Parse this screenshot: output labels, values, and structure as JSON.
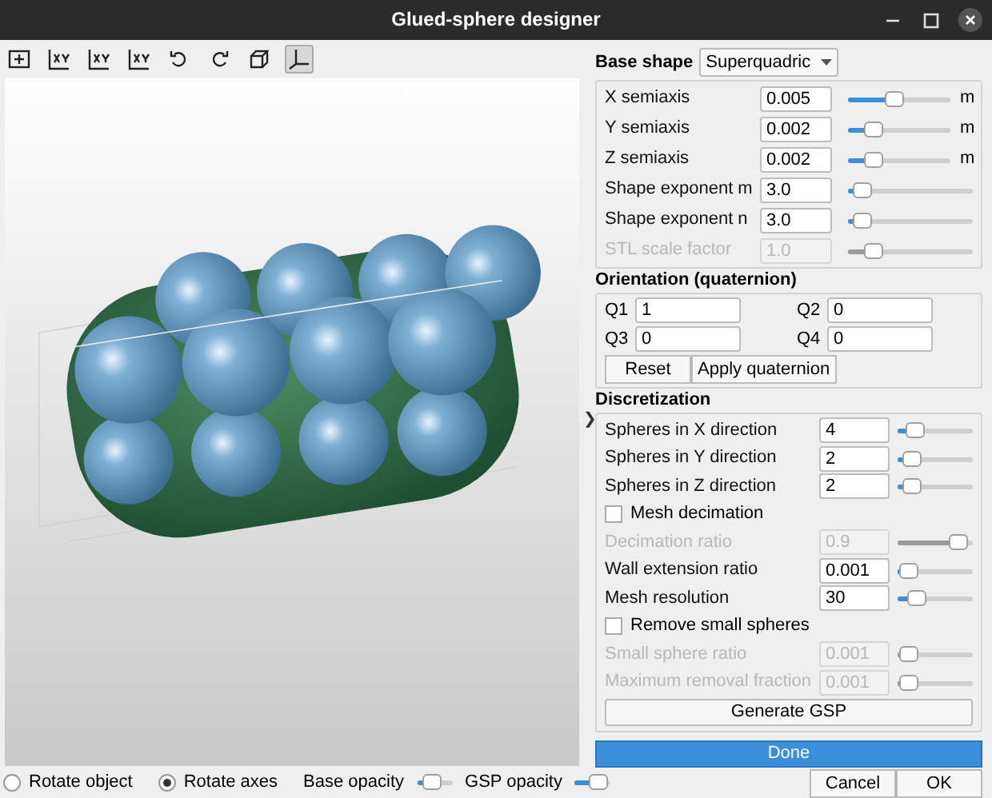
{
  "window": {
    "title": "Glued-sphere designer"
  },
  "toolbar": [
    {
      "selected": false
    },
    {
      "selected": false
    },
    {
      "selected": false
    },
    {
      "selected": false
    },
    {
      "selected": false
    },
    {
      "selected": false
    },
    {
      "selected": false
    },
    {
      "selected": true
    }
  ],
  "view_modes": [
    {
      "label": "Rotate object",
      "selected": false
    },
    {
      "label": "Rotate axes",
      "selected": true
    }
  ],
  "opacity": [
    {
      "label": "Base opacity",
      "level": 0.3
    },
    {
      "label": "GSP opacity",
      "level": 0.9
    }
  ],
  "splitter": {
    "glyph": "❯"
  },
  "base_shape": {
    "label": "Base shape",
    "value": "Superquadric"
  },
  "shape_params": [
    {
      "label": "X semiaxis",
      "value": "0.005",
      "level": 0.45,
      "unit": "m",
      "disabled": false
    },
    {
      "label": "Y semiaxis",
      "value": "0.002",
      "level": 0.2,
      "unit": "m",
      "disabled": false
    },
    {
      "label": "Z semiaxis",
      "value": "0.002",
      "level": 0.2,
      "unit": "m",
      "disabled": false
    },
    {
      "label": "Shape exponent m",
      "value": "3.0",
      "level": 0.05,
      "disabled": false
    },
    {
      "label": "Shape exponent n",
      "value": "3.0",
      "level": 0.05,
      "disabled": false
    },
    {
      "label": "STL scale factor",
      "value": "1.0",
      "level": 0.15,
      "disabled": true
    }
  ],
  "orientation": {
    "title": "Orientation (quaternion)",
    "fields": [
      {
        "label": "Q1",
        "value": "1"
      },
      {
        "label": "Q2",
        "value": "0"
      },
      {
        "label": "Q3",
        "value": "0"
      },
      {
        "label": "Q4",
        "value": "0"
      }
    ],
    "buttons": [
      "Reset",
      "Apply quaternion"
    ]
  },
  "discretization": {
    "title": "Discretization",
    "items": [
      {
        "kind": "slider",
        "label": "Spheres in X direction",
        "value": "4",
        "level": 0.15,
        "disabled": false
      },
      {
        "kind": "slider",
        "label": "Spheres in Y direction",
        "value": "2",
        "level": 0.08,
        "disabled": false
      },
      {
        "kind": "slider",
        "label": "Spheres in Z direction",
        "value": "2",
        "level": 0.08,
        "disabled": false
      },
      {
        "kind": "checkbox",
        "label": "Mesh decimation",
        "checked": false
      },
      {
        "kind": "slider",
        "label": "Decimation ratio",
        "value": "0.9",
        "level": 0.9,
        "disabled": true
      },
      {
        "kind": "slider",
        "label": "Wall extension ratio",
        "value": "0.001",
        "level": 0.02,
        "disabled": false
      },
      {
        "kind": "slider",
        "label": "Mesh resolution",
        "value": "30",
        "level": 0.18,
        "disabled": false
      },
      {
        "kind": "checkbox",
        "label": "Remove small spheres",
        "checked": false
      },
      {
        "kind": "slider",
        "label": "Small sphere ratio",
        "value": "0.001",
        "level": 0.02,
        "disabled": true
      },
      {
        "kind": "slider",
        "label": "Maximum removal fraction",
        "value": "0.001",
        "level": 0.02,
        "disabled": true
      },
      {
        "kind": "button",
        "label": "Generate GSP"
      }
    ]
  },
  "done": "Done",
  "dialog_buttons": [
    "Cancel",
    "OK"
  ]
}
